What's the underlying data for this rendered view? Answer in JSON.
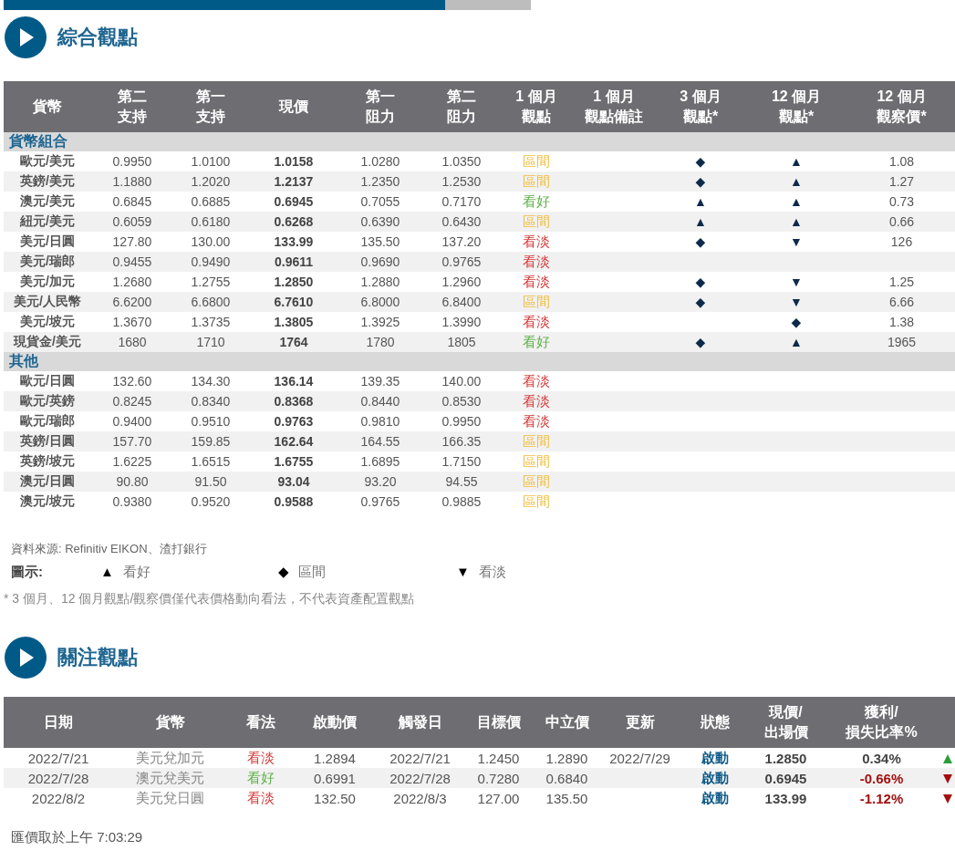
{
  "progress": {
    "level": 0.837
  },
  "section1": {
    "title": "綜合觀點",
    "columns": [
      {
        "lines": [
          "貨幣"
        ]
      },
      {
        "lines": [
          "第二",
          "支持"
        ]
      },
      {
        "lines": [
          "第一",
          "支持"
        ]
      },
      {
        "lines": [
          "現價"
        ]
      },
      {
        "lines": [
          "第一",
          "阻力"
        ]
      },
      {
        "lines": [
          "第二",
          "阻力"
        ]
      },
      {
        "lines": [
          "1 個月",
          "觀點"
        ]
      },
      {
        "lines": [
          "1 個月",
          "觀點備註"
        ]
      },
      {
        "lines": [
          "3 個月",
          "觀點*"
        ]
      },
      {
        "lines": [
          "12 個月",
          "觀點*"
        ]
      },
      {
        "lines": [
          "12 個月",
          "觀察價*"
        ]
      }
    ],
    "groups": [
      {
        "name": "貨幣組合",
        "rows": [
          {
            "currency": "歐元/美元",
            "s2": "0.9950",
            "s1": "1.0100",
            "price": "1.0158",
            "r1": "1.0280",
            "r2": "1.0350",
            "outlook": "區間",
            "kind": "range",
            "m3": "◆",
            "m12": "▲",
            "obs": "1.08"
          },
          {
            "currency": "英鎊/美元",
            "s2": "1.1880",
            "s1": "1.2020",
            "price": "1.2137",
            "r1": "1.2350",
            "r2": "1.2530",
            "outlook": "區間",
            "kind": "range",
            "m3": "◆",
            "m12": "▲",
            "obs": "1.27"
          },
          {
            "currency": "澳元/美元",
            "s2": "0.6845",
            "s1": "0.6885",
            "price": "0.6945",
            "r1": "0.7055",
            "r2": "0.7170",
            "outlook": "看好",
            "kind": "bull",
            "m3": "▲",
            "m12": "▲",
            "obs": "0.73"
          },
          {
            "currency": "紐元/美元",
            "s2": "0.6059",
            "s1": "0.6180",
            "price": "0.6268",
            "r1": "0.6390",
            "r2": "0.6430",
            "outlook": "區間",
            "kind": "range",
            "m3": "▲",
            "m12": "▲",
            "obs": "0.66"
          },
          {
            "currency": "美元/日圓",
            "s2": "127.80",
            "s1": "130.00",
            "price": "133.99",
            "r1": "135.50",
            "r2": "137.20",
            "outlook": "看淡",
            "kind": "bear",
            "m3": "◆",
            "m12": "▼",
            "obs": "126"
          },
          {
            "currency": "美元/瑞郎",
            "s2": "0.9455",
            "s1": "0.9490",
            "price": "0.9611",
            "r1": "0.9690",
            "r2": "0.9765",
            "outlook": "看淡",
            "kind": "bear"
          },
          {
            "currency": "美元/加元",
            "s2": "1.2680",
            "s1": "1.2755",
            "price": "1.2850",
            "r1": "1.2880",
            "r2": "1.2960",
            "outlook": "看淡",
            "kind": "bear",
            "m3": "◆",
            "m12": "▼",
            "obs": "1.25"
          },
          {
            "currency": "美元/人民幣",
            "s2": "6.6200",
            "s1": "6.6800",
            "price": "6.7610",
            "r1": "6.8000",
            "r2": "6.8400",
            "outlook": "區間",
            "kind": "range",
            "m3": "◆",
            "m12": "▼",
            "obs": "6.66"
          },
          {
            "currency": "美元/坡元",
            "s2": "1.3670",
            "s1": "1.3735",
            "price": "1.3805",
            "r1": "1.3925",
            "r2": "1.3990",
            "outlook": "看淡",
            "kind": "bear",
            "m12": "◆",
            "obs": "1.38"
          },
          {
            "currency": "現貨金/美元",
            "s2": "1680",
            "s1": "1710",
            "price": "1764",
            "r1": "1780",
            "r2": "1805",
            "outlook": "看好",
            "kind": "bull",
            "m3": "◆",
            "m12": "▲",
            "obs": "1965"
          }
        ]
      },
      {
        "name": "其他",
        "rows": [
          {
            "currency": "歐元/日圓",
            "s2": "132.60",
            "s1": "134.30",
            "price": "136.14",
            "r1": "139.35",
            "r2": "140.00",
            "outlook": "看淡",
            "kind": "bear"
          },
          {
            "currency": "歐元/英鎊",
            "s2": "0.8245",
            "s1": "0.8340",
            "price": "0.8368",
            "r1": "0.8440",
            "r2": "0.8530",
            "outlook": "看淡",
            "kind": "bear"
          },
          {
            "currency": "歐元/瑞郎",
            "s2": "0.9400",
            "s1": "0.9510",
            "price": "0.9763",
            "r1": "0.9810",
            "r2": "0.9950",
            "outlook": "看淡",
            "kind": "bear"
          },
          {
            "currency": "英鎊/日圓",
            "s2": "157.70",
            "s1": "159.85",
            "price": "162.64",
            "r1": "164.55",
            "r2": "166.35",
            "outlook": "區間",
            "kind": "range"
          },
          {
            "currency": "英鎊/坡元",
            "s2": "1.6225",
            "s1": "1.6515",
            "price": "1.6755",
            "r1": "1.6895",
            "r2": "1.7150",
            "outlook": "區間",
            "kind": "range"
          },
          {
            "currency": "澳元/日圓",
            "s2": "90.80",
            "s1": "91.50",
            "price": "93.04",
            "r1": "93.20",
            "r2": "94.55",
            "outlook": "區間",
            "kind": "range"
          },
          {
            "currency": "澳元/坡元",
            "s2": "0.9380",
            "s1": "0.9520",
            "price": "0.9588",
            "r1": "0.9765",
            "r2": "0.9885",
            "outlook": "區間",
            "kind": "range"
          }
        ]
      }
    ],
    "source": "資料來源: Refinitiv EIKON、渣打銀行",
    "legend": {
      "label": "圖示:",
      "items": [
        {
          "symbol": "▲",
          "text": "看好"
        },
        {
          "symbol": "◆",
          "text": "區間"
        },
        {
          "symbol": "▼",
          "text": "看淡"
        }
      ]
    },
    "footnote": "* 3 個月、12 個月觀點/觀察價僅代表價格動向看法，不代表資產配置觀點"
  },
  "section2": {
    "title": "關注觀點",
    "columns": [
      {
        "lines": [
          "日期"
        ]
      },
      {
        "lines": [
          "貨幣"
        ]
      },
      {
        "lines": [
          "看法"
        ]
      },
      {
        "lines": [
          "啟動價"
        ]
      },
      {
        "lines": [
          "觸發日"
        ]
      },
      {
        "lines": [
          "目標價"
        ]
      },
      {
        "lines": [
          "中立價"
        ]
      },
      {
        "lines": [
          "更新"
        ]
      },
      {
        "lines": [
          "狀態"
        ]
      },
      {
        "lines": [
          "現價/",
          "出場價"
        ]
      },
      {
        "lines": [
          "獲利/",
          "損失比率%"
        ]
      }
    ],
    "rows": [
      {
        "date": "2022/7/21",
        "currency": "美元兌加元",
        "view": "看淡",
        "kind": "bear",
        "start": "1.2894",
        "trigger": "2022/7/21",
        "target": "1.2450",
        "neutral": "1.2890",
        "update": "2022/7/29",
        "status": "啟動",
        "price": "1.2850",
        "pnl": "0.34%",
        "arrow": {
          "kind": "up"
        }
      },
      {
        "date": "2022/7/28",
        "currency": "澳元兌美元",
        "view": "看好",
        "kind": "bull",
        "start": "0.6991",
        "trigger": "2022/7/28",
        "target": "0.7280",
        "neutral": "0.6840",
        "status": "啟動",
        "price": "0.6945",
        "pnl": "-0.66%",
        "arrow": {
          "kind": "down"
        }
      },
      {
        "date": "2022/8/2",
        "currency": "美元兌日圓",
        "view": "看淡",
        "kind": "bear",
        "start": "132.50",
        "trigger": "2022/8/3",
        "target": "127.00",
        "neutral": "135.50",
        "status": "啟動",
        "price": "133.99",
        "pnl": "-1.12%",
        "arrow": {
          "kind": "down"
        }
      }
    ],
    "timestamp": "匯價取於上午 7:03:29"
  }
}
